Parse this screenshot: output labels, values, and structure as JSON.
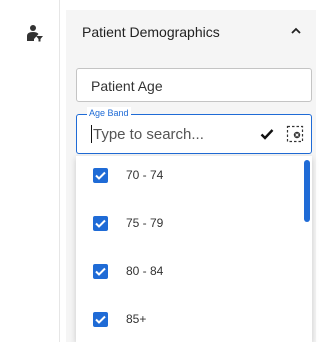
{
  "sidebar": {
    "icon": "person-filter-icon"
  },
  "panel": {
    "title": "Patient Demographics",
    "collapse_icon": "chevron-up-icon"
  },
  "patient_age_field": {
    "label": "Patient Age"
  },
  "age_band_field": {
    "legend": "Age Band",
    "value": "",
    "placeholder": "Type to search...",
    "confirm_icon": "check-icon",
    "clear_icon": "clear-selection-icon"
  },
  "options": [
    {
      "label": "70 - 74",
      "checked": true
    },
    {
      "label": "75 - 79",
      "checked": true
    },
    {
      "label": "80 - 84",
      "checked": true
    },
    {
      "label": "85+",
      "checked": true
    }
  ],
  "colors": {
    "accent": "#1f6bd6",
    "panel_bg": "#f5f5f5"
  }
}
